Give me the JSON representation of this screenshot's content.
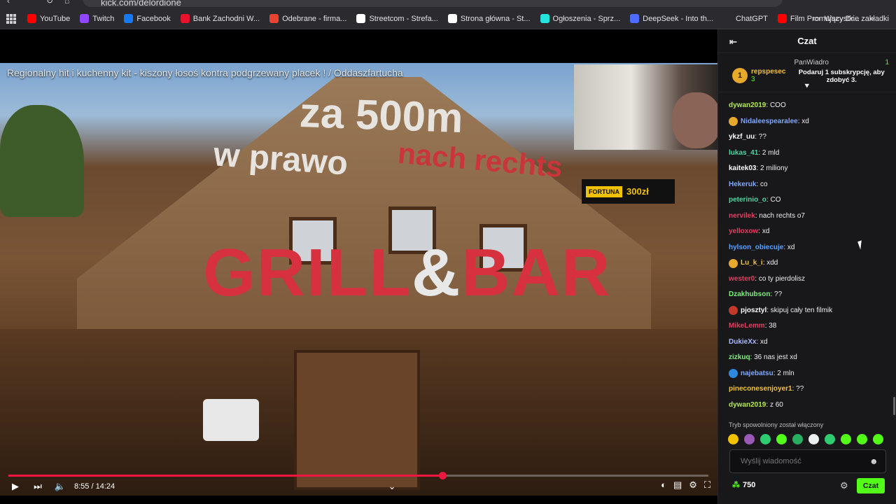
{
  "browser": {
    "url": "kick.com/delordione",
    "bookmarks": [
      {
        "label": "YouTube",
        "color": "#ff0000"
      },
      {
        "label": "Twitch",
        "color": "#9146ff"
      },
      {
        "label": "Facebook",
        "color": "#1877f2"
      },
      {
        "label": "Bank Zachodni W...",
        "color": "#e8132b"
      },
      {
        "label": "Odebrane - firma...",
        "color": "#ea4335"
      },
      {
        "label": "Streetcom - Strefa...",
        "color": "#ffffff"
      },
      {
        "label": "Strona główna - St...",
        "color": "#ffffff"
      },
      {
        "label": "Ogłoszenia - Sprz...",
        "color": "#23e5db"
      },
      {
        "label": "DeepSeek - Into th...",
        "color": "#4d6bfe"
      },
      {
        "label": "ChatGPT",
        "color": "#2b2b2f"
      },
      {
        "label": "Film Promujący Dr...",
        "color": "#ff0000"
      }
    ],
    "overflow_label": "»",
    "all_bookmarks_label": "Wszystkie zakładki"
  },
  "video": {
    "title": "Regionalny hit i kuchenny kit - kiszony łosoś kontra podgrzewany placek ! / Oddaszfartucha",
    "overlay_line1": "za 500m",
    "overlay_line2": "w prawo",
    "overlay_line3": "nach rechts",
    "sign_grill": "GRILL",
    "sign_amp": "&",
    "sign_bar": "BAR",
    "sponsor": "FORTUNA",
    "sponsor_amount": "300zł",
    "time_label": "8:55 / 14:24",
    "progress": 0.62
  },
  "chat": {
    "title": "Czat",
    "pinned": {
      "leader_rank": "1",
      "leader_name": "repspesec",
      "leader_count": "3",
      "gifter_name": "PanWiadro",
      "gifter_count": "1",
      "promo": "Podaruj 1 subskrypcję, aby zdobyć 3."
    },
    "messages": [
      {
        "user": "dywan2019",
        "text": "COO",
        "color": "#b5e853",
        "badge": ""
      },
      {
        "user": "Nidaleespearalee",
        "text": "xd",
        "color": "#7ea7ff",
        "badge": "gold"
      },
      {
        "user": "ykzf_uu",
        "text": "??",
        "color": "#ffffff",
        "badge": ""
      },
      {
        "user": "lukas_41",
        "text": "2 mld",
        "color": "#53d3a0",
        "badge": ""
      },
      {
        "user": "kaitek03",
        "text": "2 miliony",
        "color": "#ffffff",
        "badge": ""
      },
      {
        "user": "Hekeruk",
        "text": "co",
        "color": "#7ea7ff",
        "badge": ""
      },
      {
        "user": "peterinio_o",
        "text": "CO",
        "color": "#53d3a0",
        "badge": ""
      },
      {
        "user": "nervilek",
        "text": "nach rechts o7",
        "color": "#e04060",
        "badge": ""
      },
      {
        "user": "yelloxow",
        "text": "xd",
        "color": "#e04060",
        "badge": ""
      },
      {
        "user": "hylson_obiecuje",
        "text": "xd",
        "color": "#5aa0ff",
        "badge": ""
      },
      {
        "user": "Lu_k_i",
        "text": "xdd",
        "color": "#f0c040",
        "badge": "gold"
      },
      {
        "user": "wester0",
        "text": "co ty pierdolisz",
        "color": "#e04060",
        "badge": ""
      },
      {
        "user": "Dzakhubson",
        "text": "??",
        "color": "#7df07d",
        "badge": ""
      },
      {
        "user": "pjosztyl",
        "text": "skipuj cały ten filmik",
        "color": "#ffffff",
        "badge": "red"
      },
      {
        "user": "MikeLemm",
        "text": "38",
        "color": "#e04060",
        "badge": ""
      },
      {
        "user": "DukieXx",
        "text": "xd",
        "color": "#a9b8ff",
        "badge": ""
      },
      {
        "user": "zizkuq",
        "text": "36 nas jest xd",
        "color": "#7df07d",
        "badge": ""
      },
      {
        "user": "najebatsu",
        "text": "2 mln",
        "color": "#7ea7ff",
        "badge": "blue"
      },
      {
        "user": "pineconesenjoyer1",
        "text": "??",
        "color": "#f0c040",
        "badge": ""
      },
      {
        "user": "dywan2019",
        "text": "z 60",
        "color": "#b5e853",
        "badge": ""
      }
    ],
    "slow_mode": "Tryb spowolniony został włączony",
    "input_placeholder": "Wyślij wiadomość",
    "points": "750",
    "send_label": "Czat"
  }
}
